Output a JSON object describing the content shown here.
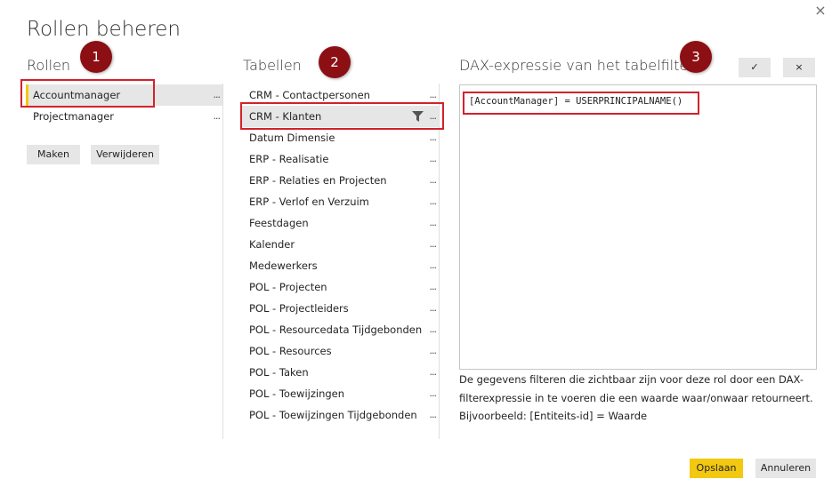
{
  "dialog": {
    "title": "Rollen beheren",
    "close_glyph": "×"
  },
  "roles": {
    "title": "Rollen",
    "items": [
      {
        "label": "Accountmanager",
        "selected": true
      },
      {
        "label": "Projectmanager",
        "selected": false
      }
    ],
    "more_glyph": "...",
    "make_label": "Maken",
    "delete_label": "Verwijderen"
  },
  "tables": {
    "title": "Tabellen",
    "more_glyph": "...",
    "items": [
      {
        "label": "CRM - Contactpersonen"
      },
      {
        "label": "CRM - Klanten",
        "selected": true,
        "filtered": true
      },
      {
        "label": "Datum Dimensie"
      },
      {
        "label": "ERP - Realisatie"
      },
      {
        "label": "ERP - Relaties en Projecten"
      },
      {
        "label": "ERP - Verlof en Verzuim"
      },
      {
        "label": "Feestdagen"
      },
      {
        "label": "Kalender"
      },
      {
        "label": "Medewerkers"
      },
      {
        "label": "POL - Projecten"
      },
      {
        "label": "POL - Projectleiders"
      },
      {
        "label": "POL - Resourcedata Tijdgebonden"
      },
      {
        "label": "POL - Resources"
      },
      {
        "label": "POL - Taken"
      },
      {
        "label": "POL - Toewijzingen"
      },
      {
        "label": "POL - Toewijzingen Tijdgebonden"
      }
    ]
  },
  "dax": {
    "title": "DAX-expressie van het tabelfilter",
    "check_glyph": "✓",
    "x_glyph": "×",
    "expression": "[AccountManager] = USERPRINCIPALNAME()",
    "help_lines": [
      "De gegevens filteren die zichtbaar zijn voor deze rol door een DAX-",
      "filterexpressie in te voeren die een waarde waar/onwaar retourneert.",
      "Bijvoorbeeld: [Entiteits-id] = Waarde"
    ]
  },
  "footer": {
    "save_label": "Opslaan",
    "cancel_label": "Annuleren"
  },
  "annotations": {
    "badge_1": "1",
    "badge_2": "2",
    "badge_3": "3",
    "badge_color": "#8c0f14",
    "highlight_color": "#d3212c"
  },
  "colors": {
    "accent": "#f2c811",
    "selected_bg": "#e6e6e6",
    "button_bg": "#e6e6e6"
  }
}
